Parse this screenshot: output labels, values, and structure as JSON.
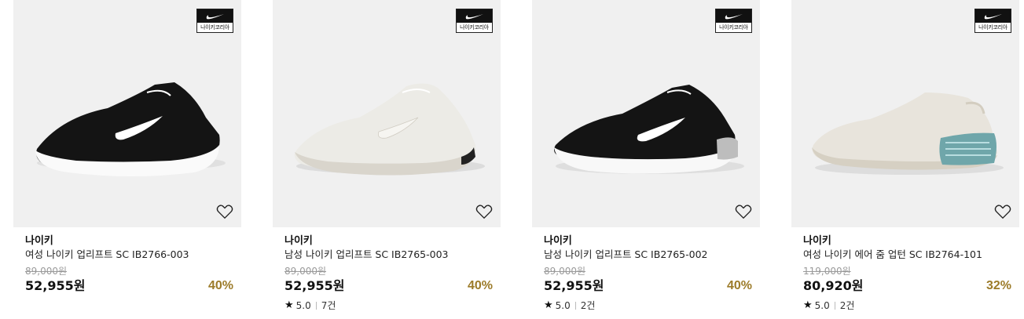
{
  "badge_label": "나이키코리아",
  "colors": {
    "discount": "#9c7b29",
    "tile_bg": "#f0f0f0"
  },
  "products": [
    {
      "brand": "나이키",
      "name": "여성 나이키 업리프트 SC IB2766-003",
      "original_price": "89,000원",
      "sale_price": "52,955원",
      "discount": "40%",
      "rating": "",
      "review_count": "",
      "shoe_color": "black"
    },
    {
      "brand": "나이키",
      "name": "남성 나이키 업리프트 SC IB2765-003",
      "original_price": "89,000원",
      "sale_price": "52,955원",
      "discount": "40%",
      "rating": "5.0",
      "review_count": "7건",
      "shoe_color": "cream"
    },
    {
      "brand": "나이키",
      "name": "남성 나이키 업리프트 SC IB2765-002",
      "original_price": "89,000원",
      "sale_price": "52,955원",
      "discount": "40%",
      "rating": "5.0",
      "review_count": "2건",
      "shoe_color": "black"
    },
    {
      "brand": "나이키",
      "name": "여성 나이키 에어 줌 업턴 SC IB2764-101",
      "original_price": "119,000원",
      "sale_price": "80,920원",
      "discount": "32%",
      "rating": "5.0",
      "review_count": "2건",
      "shoe_color": "cream-airzoom"
    }
  ]
}
